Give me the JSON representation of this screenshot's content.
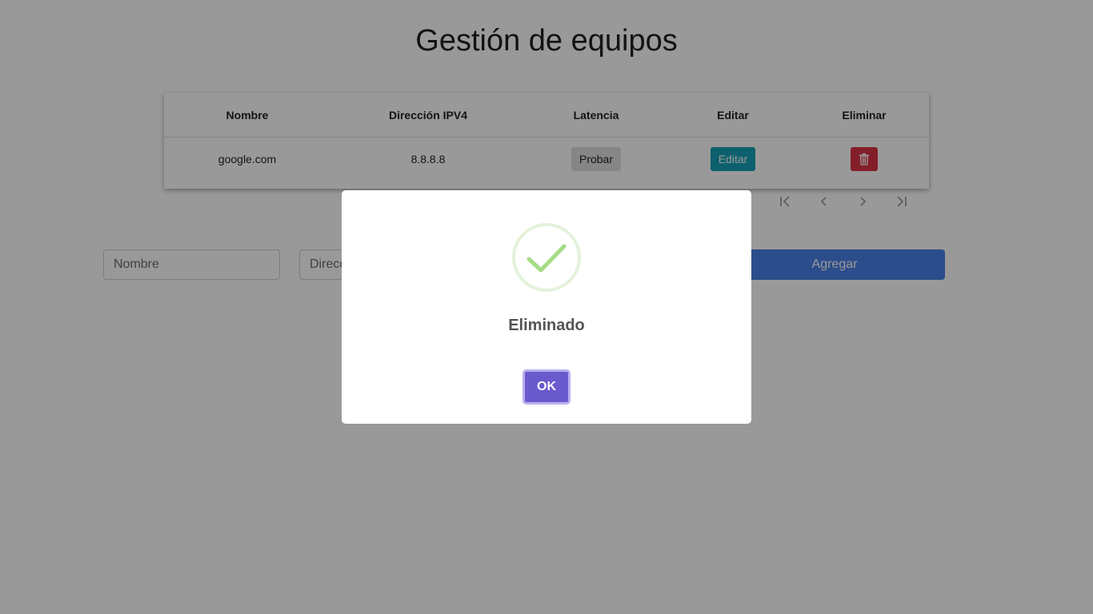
{
  "page": {
    "title": "Gestión de equipos"
  },
  "table": {
    "headers": [
      "Nombre",
      "Dirección IPV4",
      "Latencia",
      "Editar",
      "Eliminar"
    ],
    "rows": [
      {
        "nombre": "google.com",
        "ipv4": "8.8.8.8",
        "latencia_button": "Probar",
        "editar_button": "Editar",
        "eliminar_icon": "trash-icon"
      }
    ]
  },
  "pagination": {
    "icons": [
      "first-page-icon",
      "prev-page-icon",
      "next-page-icon",
      "last-page-icon"
    ]
  },
  "form": {
    "nombre_placeholder": "Nombre",
    "direccion_placeholder": "Dirección IPV4",
    "submit_label": "Agregar"
  },
  "modal": {
    "icon": "success-check-icon",
    "title": "Eliminado",
    "confirm_label": "OK"
  },
  "colors": {
    "editar": "#17a2b8",
    "eliminar": "#dc3545",
    "agregar": "#4a80e8",
    "ok": "#6a5acd",
    "success": "#a5dc86"
  }
}
